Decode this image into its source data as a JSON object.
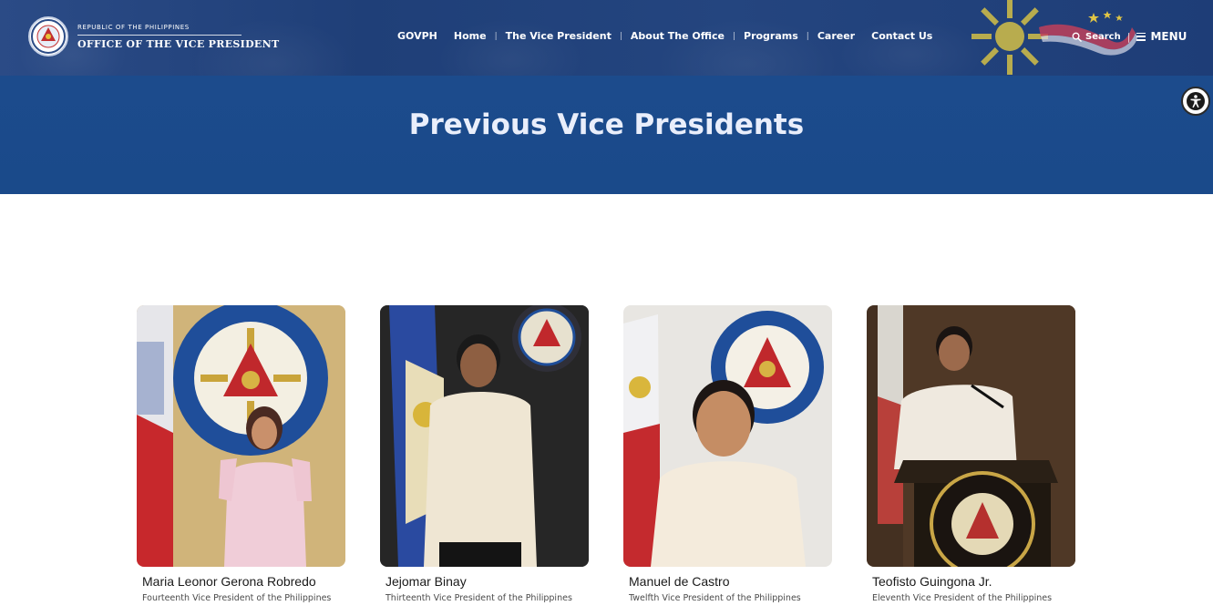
{
  "brand": {
    "small": "REPUBLIC OF THE PHILIPPINES",
    "big": "OFFICE OF THE VICE PRESIDENT"
  },
  "nav": {
    "items": [
      {
        "label": "GOVPH"
      },
      {
        "label": "Home"
      },
      {
        "label": "The Vice President"
      },
      {
        "label": "About The Office"
      },
      {
        "label": "Programs"
      },
      {
        "label": "Career"
      },
      {
        "label": "Contact Us"
      }
    ],
    "separator": "|"
  },
  "tools": {
    "search_label": "Search",
    "separator": "|",
    "menu_label": "MENU"
  },
  "banner": {
    "title": "Previous Vice Presidents"
  },
  "vice_presidents": [
    {
      "name": "Maria Leonor Gerona Robredo",
      "role": "Fourteenth Vice President of the Philippines"
    },
    {
      "name": "Jejomar Binay",
      "role": "Thirteenth Vice President of the Philippines"
    },
    {
      "name": "Manuel de Castro",
      "role": "Twelfth Vice President of the Philippines"
    },
    {
      "name": "Teofisto Guingona Jr.",
      "role": "Eleventh Vice President of the Philippines"
    }
  ],
  "colors": {
    "header_bg": "#233f7c",
    "banner_bg": "#1b4a8b",
    "banner_text": "#e9eefb",
    "sun_gold": "#c9b84a"
  },
  "icons": {
    "search": "search-icon",
    "menu": "hamburger-icon",
    "accessibility": "accessibility-icon",
    "seal": "ovp-seal-logo"
  }
}
